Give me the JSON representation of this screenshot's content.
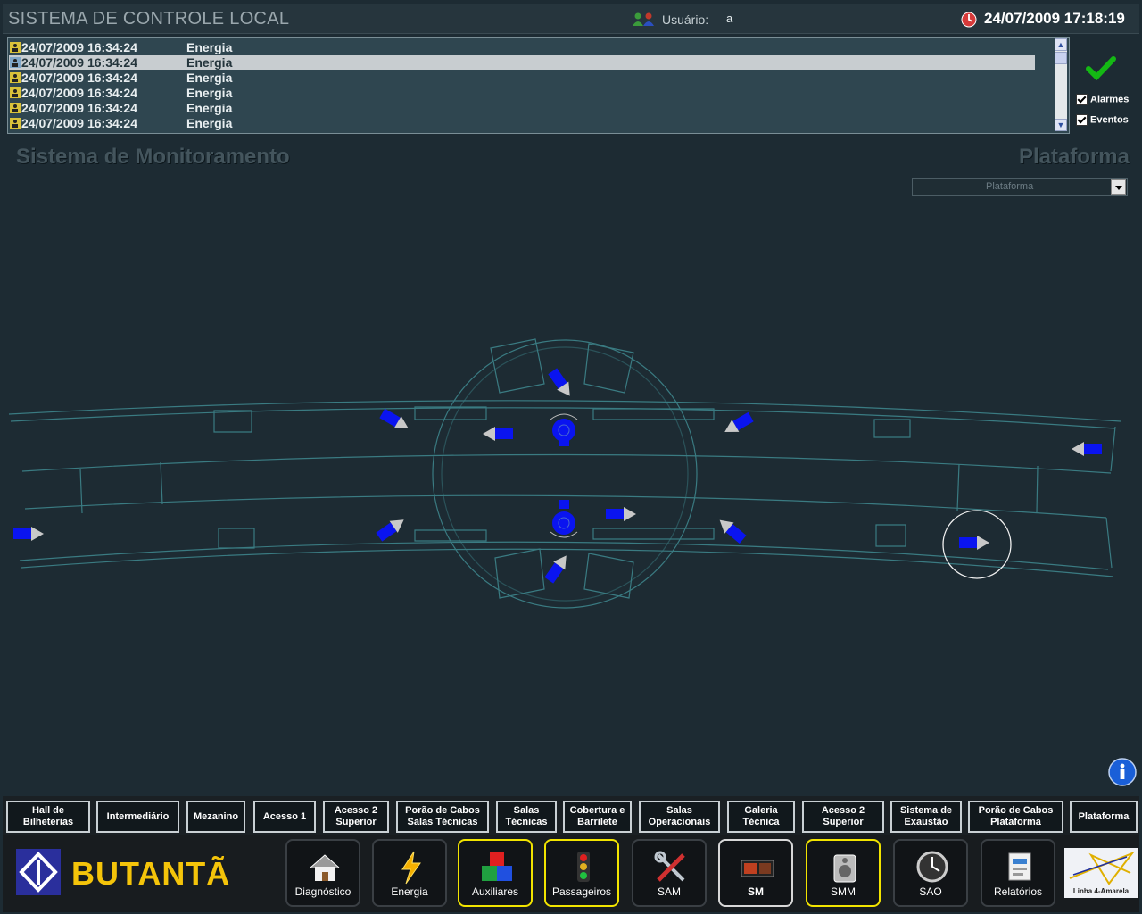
{
  "header": {
    "app_title": "SISTEMA DE CONTROLE LOCAL",
    "user_label": "Usuário:",
    "user_value": "a",
    "datetime": "24/07/2009 17:18:19"
  },
  "events": {
    "rows": [
      {
        "timestamp": "24/07/2009 16:34:24",
        "type": "Energia",
        "selected": false
      },
      {
        "timestamp": "24/07/2009 16:34:24",
        "type": "Energia",
        "selected": true
      },
      {
        "timestamp": "24/07/2009 16:34:24",
        "type": "Energia",
        "selected": false
      },
      {
        "timestamp": "24/07/2009 16:34:24",
        "type": "Energia",
        "selected": false
      },
      {
        "timestamp": "24/07/2009 16:34:24",
        "type": "Energia",
        "selected": false
      },
      {
        "timestamp": "24/07/2009 16:34:24",
        "type": "Energia",
        "selected": false
      }
    ],
    "filters": {
      "alarms_label": "Alarmes",
      "alarms_checked": true,
      "events_label": "Eventos",
      "events_checked": true
    }
  },
  "section": {
    "title": "Sistema de Monitoramento",
    "view_title": "Plataforma",
    "view_select_value": "Plataforma"
  },
  "nav": [
    "Hall de Bilheterias",
    "Intermediário",
    "Mezanino",
    "Acesso 1",
    "Acesso 2 Superior",
    "Porão de Cabos Salas Técnicas",
    "Salas Técnicas",
    "Cobertura e Barrilete",
    "Salas Operacionais",
    "Galeria Técnica",
    "Acesso 2 Superior",
    "Sistema de Exaustão",
    "Porão de Cabos Plataforma",
    "Plataforma"
  ],
  "station": {
    "name": "BUTANTÃ",
    "line_label": "Linha 4-Amarela"
  },
  "systems": [
    {
      "label": "Diagnóstico",
      "icon": "house-icon",
      "state": "normal"
    },
    {
      "label": "Energia",
      "icon": "lightning-icon",
      "state": "normal"
    },
    {
      "label": "Auxiliares",
      "icon": "cubes-icon",
      "state": "highlight"
    },
    {
      "label": "Passageiros",
      "icon": "traffic-light-icon",
      "state": "highlight"
    },
    {
      "label": "SAM",
      "icon": "tools-icon",
      "state": "normal"
    },
    {
      "label": "SM",
      "icon": "camera-icon",
      "state": "active"
    },
    {
      "label": "SMM",
      "icon": "speaker-icon",
      "state": "highlight"
    },
    {
      "label": "SAO",
      "icon": "clock-icon",
      "state": "normal"
    },
    {
      "label": "Relatórios",
      "icon": "report-icon",
      "state": "normal"
    }
  ],
  "colors": {
    "background": "#1d2b33",
    "highlight_border": "#f2e400",
    "camera": "#0a14f0",
    "station_name": "#f4c40a"
  }
}
